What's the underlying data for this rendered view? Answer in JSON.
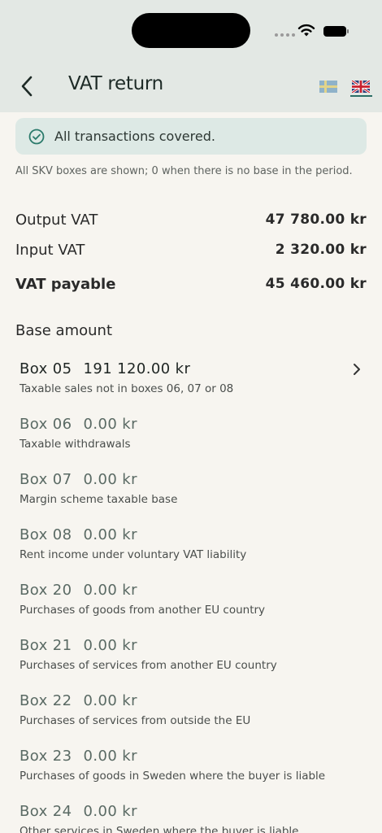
{
  "header": {
    "title": "VAT return",
    "languages": [
      "sv",
      "en"
    ],
    "selected_language": "en"
  },
  "banner": {
    "icon": "check-circle-icon",
    "text": "All transactions covered."
  },
  "note": "All SKV boxes are shown; 0 when there is no base in the period.",
  "totals": [
    {
      "label": "Output VAT",
      "value": "47 780.00 kr",
      "bold": false
    },
    {
      "label": "Input VAT",
      "value": "2 320.00 kr",
      "bold": false
    },
    {
      "label": "VAT payable",
      "value": "45 460.00 kr",
      "bold": true
    }
  ],
  "base_section": {
    "heading": "Base amount"
  },
  "boxes": [
    {
      "box": "Box 05",
      "amount": "191 120.00 kr",
      "description": "Taxable sales not in boxes 06, 07 or 08",
      "active": true
    },
    {
      "box": "Box 06",
      "amount": "0.00 kr",
      "description": "Taxable withdrawals",
      "active": false
    },
    {
      "box": "Box 07",
      "amount": "0.00 kr",
      "description": "Margin scheme taxable base",
      "active": false
    },
    {
      "box": "Box 08",
      "amount": "0.00 kr",
      "description": "Rent income under voluntary VAT liability",
      "active": false
    },
    {
      "box": "Box 20",
      "amount": "0.00 kr",
      "description": "Purchases of goods from another EU country",
      "active": false
    },
    {
      "box": "Box 21",
      "amount": "0.00 kr",
      "description": "Purchases of services from another EU country",
      "active": false
    },
    {
      "box": "Box 22",
      "amount": "0.00 kr",
      "description": "Purchases of services from outside the EU",
      "active": false
    },
    {
      "box": "Box 23",
      "amount": "0.00 kr",
      "description": "Purchases of goods in Sweden where the buyer is liable",
      "active": false
    },
    {
      "box": "Box 24",
      "amount": "0.00 kr",
      "description": "Other services in Sweden where the buyer is liable",
      "active": false
    }
  ],
  "colors": {
    "header_bg": "#e3e8e4",
    "accent": "#2b6e66",
    "banner_bg": "#dde9e5",
    "page_bg": "#f7f5f0"
  }
}
